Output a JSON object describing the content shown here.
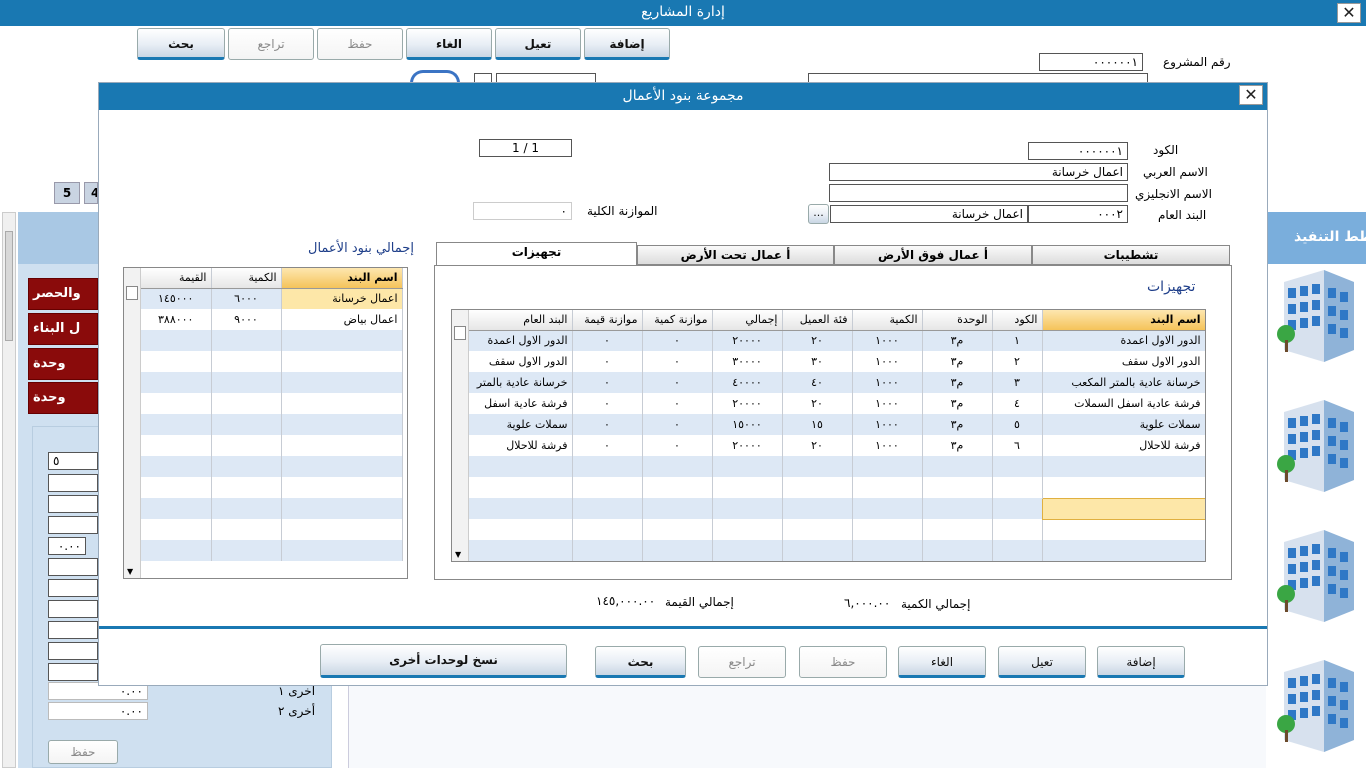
{
  "main_window": {
    "title": "إدارة المشاريع",
    "toolbar": {
      "add": "إضافة",
      "edit": "تعيل",
      "cancel": "الغاء",
      "save": "حفظ",
      "undo": "تراجع",
      "search": "بحث"
    },
    "project_number_label": "رقم المشروع",
    "project_number_value": "٠٠٠٠٠٠١",
    "page_tabs": [
      "5",
      "4"
    ],
    "side_buttons": [
      "والحصر",
      "ل البناء",
      "وحدة",
      "وحدة"
    ],
    "left_fields": [
      "٥",
      "",
      "",
      "",
      "٠.٠٠",
      "",
      "",
      "",
      "",
      "",
      "",
      ""
    ],
    "other1_label": "أخرى ١",
    "other1_value": "٠.٠٠",
    "other2_label": "أخرى ٢",
    "other2_value": "٠.٠٠",
    "left_save": "حفظ",
    "right_panel_title": "المخطط التنفيذ"
  },
  "dialog": {
    "title": "مجموعة بنود الأعمال",
    "code_label": "الكود",
    "code_value": "٠٠٠٠٠٠١",
    "arabic_name_label": "الاسم العربي",
    "arabic_name_value": "اعمال خرسانة",
    "english_name_label": "الاسم الانجليزي",
    "english_name_value": "",
    "general_item_label": "البند العام",
    "general_item_code": "٠٠٠٢",
    "general_item_name": "اعمال خرسانة",
    "browse_label": "...",
    "record_position": "1 / 1",
    "total_budget_label": "الموازنة الكلية",
    "total_budget_value": "٠",
    "tabs": [
      "تشطيبات",
      "أ عمال فوق الأرض",
      "أ عمال تحت الأرض",
      "تجهيزات"
    ],
    "active_tab": "تجهيزات",
    "panel_title": "تجهيزات",
    "items_table": {
      "headers": [
        "اسم البند",
        "الكود",
        "الوحدة",
        "الكمية",
        "فئة العميل",
        "إجمالي",
        "موازنة كمية",
        "موازنة قيمة",
        "البند العام"
      ],
      "rows": [
        [
          "الدور الاول اعمدة",
          "١",
          "م٣",
          "١٠٠٠",
          "٢٠",
          "٢٠٠٠٠",
          "٠",
          "٠",
          "الدور الاول اعمدة"
        ],
        [
          "الدور الاول سقف",
          "٢",
          "م٣",
          "١٠٠٠",
          "٣٠",
          "٣٠٠٠٠",
          "٠",
          "٠",
          "الدور الاول سقف"
        ],
        [
          "خرسانة عادية بالمتر المكعب",
          "٣",
          "م٣",
          "١٠٠٠",
          "٤٠",
          "٤٠٠٠٠",
          "٠",
          "٠",
          "خرسانة عادية بالمتر"
        ],
        [
          "فرشة عادية اسفل السملات",
          "٤",
          "م٣",
          "١٠٠٠",
          "٢٠",
          "٢٠٠٠٠",
          "٠",
          "٠",
          "فرشة عادية اسفل"
        ],
        [
          "سملات علوية",
          "٥",
          "م٣",
          "١٠٠٠",
          "١٥",
          "١٥٠٠٠",
          "٠",
          "٠",
          "سملات علوية"
        ],
        [
          "فرشة للاحلال",
          "٦",
          "م٣",
          "١٠٠٠",
          "٢٠",
          "٢٠٠٠٠",
          "٠",
          "٠",
          "فرشة للاحلال"
        ]
      ]
    },
    "summary_title": "إجمالي بنود الأعمال",
    "summary_table": {
      "headers": [
        "اسم البند",
        "الكمية",
        "القيمة"
      ],
      "rows": [
        [
          "اعمال خرسانة",
          "٦٠٠٠",
          "١٤٥٠٠٠"
        ],
        [
          "اعمال بياض",
          "٩٠٠٠",
          "٣٨٨٠٠٠"
        ]
      ]
    },
    "total_quantity_label": "إجمالي الكمية",
    "total_quantity_value": "٦,٠٠٠.٠٠",
    "total_value_label": "إجمالي القيمة",
    "total_value_value": "١٤٥,٠٠٠.٠٠",
    "buttons": {
      "add": "إضافة",
      "edit": "تعيل",
      "cancel": "الغاء",
      "save": "حفظ",
      "undo": "تراجع",
      "search": "بحث",
      "copy": "نسخ لوحدات أخرى"
    }
  }
}
